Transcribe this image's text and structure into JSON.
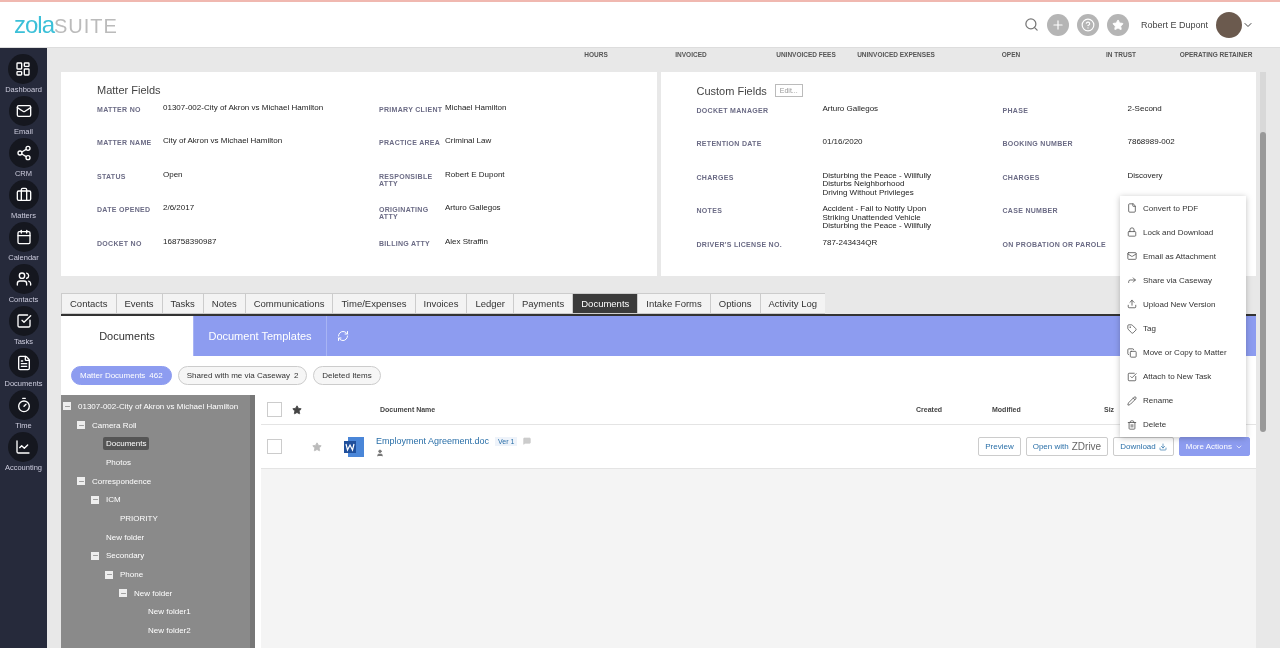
{
  "header": {
    "logo_primary": "zola",
    "logo_secondary": "SUITE",
    "user_name": "Robert E Dupont"
  },
  "sidebar": {
    "items": [
      {
        "label": "Dashboard"
      },
      {
        "label": "Email"
      },
      {
        "label": "CRM"
      },
      {
        "label": "Matters"
      },
      {
        "label": "Calendar"
      },
      {
        "label": "Contacts"
      },
      {
        "label": "Tasks"
      },
      {
        "label": "Documents"
      },
      {
        "label": "Time"
      },
      {
        "label": "Accounting"
      }
    ]
  },
  "stats": [
    "HOURS",
    "INVOICED",
    "UNINVOICED FEES",
    "UNINVOICED EXPENSES",
    "OPEN",
    "IN TRUST",
    "OPERATING RETAINER"
  ],
  "matter_fields": {
    "title": "Matter Fields",
    "fields": [
      {
        "label": "MATTER NO",
        "value": "01307-002-City of Akron vs Michael Hamilton"
      },
      {
        "label": "PRIMARY CLIENT",
        "value": "Michael Hamilton"
      },
      {
        "label": "MATTER NAME",
        "value": "City of Akron vs Michael Hamilton"
      },
      {
        "label": "PRACTICE AREA",
        "value": "Criminal Law"
      },
      {
        "label": "STATUS",
        "value": "Open"
      },
      {
        "label": "RESPONSIBLE ATTY",
        "value": "Robert E Dupont"
      },
      {
        "label": "DATE OPENED",
        "value": "2/6/2017"
      },
      {
        "label": "ORIGINATING ATTY",
        "value": "Arturo Gallegos"
      },
      {
        "label": "DOCKET NO",
        "value": "168758390987"
      },
      {
        "label": "BILLING ATTY",
        "value": "Alex Straffin"
      }
    ]
  },
  "custom_fields": {
    "title": "Custom Fields",
    "edit_button": "Edit...",
    "fields": [
      {
        "label": "DOCKET MANAGER",
        "value": "Arturo Gallegos"
      },
      {
        "label": "PHASE",
        "value": "2-Second"
      },
      {
        "label": "RETENTION DATE",
        "value": "01/16/2020"
      },
      {
        "label": "BOOKING NUMBER",
        "value": "7868989-002"
      },
      {
        "label": "CHARGES",
        "value": "Disturbing the Peace - Willfully\nDisturbs Neighborhood\nDriving Without Privileges"
      },
      {
        "label": "CHARGES",
        "value": "Discovery"
      },
      {
        "label": "NOTES",
        "value": "Accident - Fail to Notify Upon\nStriking Unattended Vehicle\nDisturbing the Peace - Willfully"
      },
      {
        "label": "CASE NUMBER"
      },
      {
        "label": "DRIVER'S LICENSE NO.",
        "value": "787-243434QR"
      },
      {
        "label": "ON PROBATION OR PAROLE"
      }
    ]
  },
  "tabs": [
    {
      "label": "Contacts",
      "selected": false
    },
    {
      "label": "Events",
      "selected": false
    },
    {
      "label": "Tasks",
      "selected": false
    },
    {
      "label": "Notes",
      "selected": false
    },
    {
      "label": "Communications",
      "selected": false
    },
    {
      "label": "Time/Expenses",
      "selected": false
    },
    {
      "label": "Invoices",
      "selected": false
    },
    {
      "label": "Ledger",
      "selected": false
    },
    {
      "label": "Payments",
      "selected": false
    },
    {
      "label": "Documents",
      "selected": true
    },
    {
      "label": "Intake Forms",
      "selected": false
    },
    {
      "label": "Options",
      "selected": false
    },
    {
      "label": "Activity Log",
      "selected": false
    }
  ],
  "document_tabs": [
    {
      "label": "Documents",
      "selected": true
    },
    {
      "label": "Document Templates",
      "selected": false
    }
  ],
  "filters": [
    {
      "label": "Matter Documents",
      "count": "462",
      "selected": true
    },
    {
      "label": "Shared with me via Caseway",
      "count": "2",
      "selected": false
    },
    {
      "label": "Deleted Items",
      "selected": false
    }
  ],
  "tree": [
    {
      "label": "01307-002-City of Akron vs Michael Hamilton",
      "expanded": true,
      "selected": false,
      "children": [
        {
          "label": "Camera Roll",
          "expanded": true,
          "selected": false,
          "children": [
            {
              "label": "Documents",
              "selected": true
            },
            {
              "label": "Photos",
              "selected": false
            }
          ]
        },
        {
          "label": "Correspondence",
          "expanded": true,
          "selected": false,
          "children": [
            {
              "label": "ICM",
              "expanded": true,
              "selected": false,
              "children": [
                {
                  "label": "PRIORITY",
                  "selected": false
                }
              ]
            },
            {
              "label": "New folder",
              "selected": false
            },
            {
              "label": "Secondary",
              "expanded": true,
              "selected": false,
              "children": [
                {
                  "label": "Phone",
                  "expanded": true,
                  "selected": false,
                  "children": [
                    {
                      "label": "New folder",
                      "expanded": true,
                      "selected": false,
                      "children": [
                        {
                          "label": "New folder1",
                          "selected": false
                        },
                        {
                          "label": "New folder2",
                          "selected": false
                        }
                      ]
                    }
                  ]
                }
              ]
            }
          ]
        }
      ]
    }
  ],
  "table": {
    "all_checked": false,
    "columns": [
      "Document Name",
      "Created",
      "Modified",
      "Siz"
    ],
    "rows": [
      {
        "checked": false,
        "starred": false,
        "name": "Employment Agreement.doc",
        "version": "Ver 1",
        "buttons": [
          "Preview",
          "Open with",
          "Download",
          "More Actions"
        ],
        "drive_label": "ZDrive"
      }
    ]
  },
  "menu": {
    "items": [
      "Convert to PDF",
      "Lock and Download",
      "Email as Attachment",
      "Share via Caseway",
      "Upload New Version",
      "Tag",
      "Move or Copy to Matter",
      "Attach to New Task",
      "Rename",
      "Delete"
    ]
  }
}
